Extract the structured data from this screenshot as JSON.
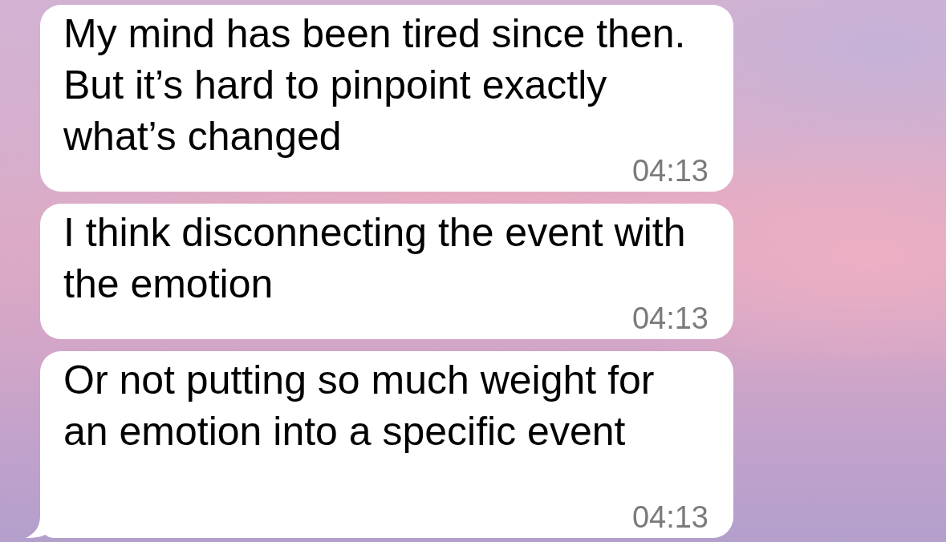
{
  "messages": [
    {
      "text": "My mind has been tired since then. But it’s hard to pinpoint exactly what’s changed",
      "time": "04:13",
      "tail": false
    },
    {
      "text": "I think disconnecting the event with the emotion",
      "time": "04:13",
      "tail": false
    },
    {
      "text": "Or not putting so much weight for an emotion into a specific event",
      "time": "04:13",
      "tail": true
    }
  ]
}
